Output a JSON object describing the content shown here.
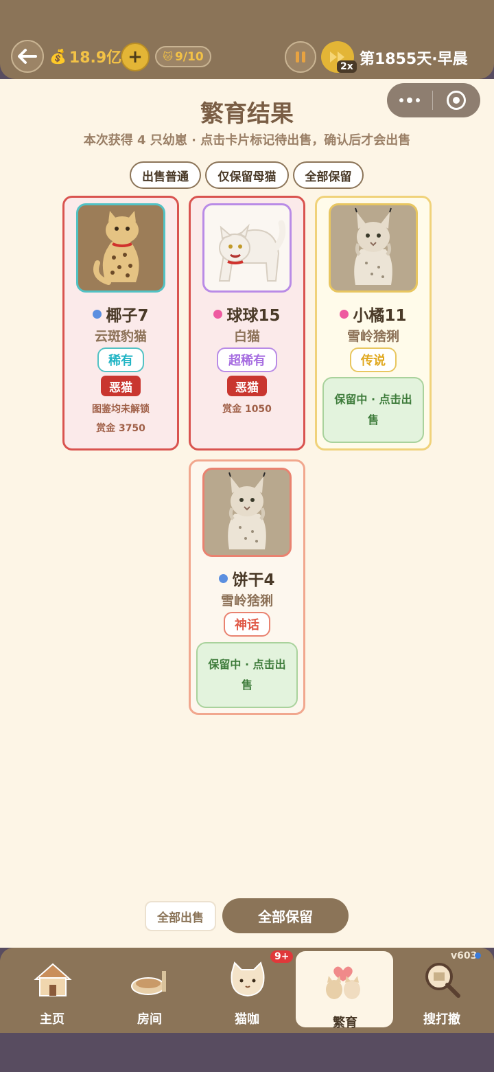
{
  "topbar": {
    "money": "18.9亿",
    "cat_count": "9/10",
    "speed": "2x",
    "day": "第1855天·早晨"
  },
  "page": {
    "title": "繁育结果",
    "subtitle": "本次获得 4 只幼崽 · 点击卡片标记待出售，确认后才会出售"
  },
  "filters": [
    "出售普通",
    "仅保留母猫",
    "全部保留"
  ],
  "cards": [
    {
      "name": "椰子7",
      "breed": "云斑豹猫",
      "rarity": "稀有",
      "tag": "恶猫",
      "note": "图鉴均未解锁",
      "bounty": "赏金 3750",
      "gender_color": "#5b8fe0",
      "rarity_color": "#20b4c4",
      "frame_color": "#52c2c4"
    },
    {
      "name": "球球15",
      "breed": "白猫",
      "rarity": "超稀有",
      "tag": "恶猫",
      "bounty": "赏金 1050",
      "gender_color": "#ee5aa0",
      "rarity_color": "#a56be0",
      "frame_color": "#b98be6"
    },
    {
      "name": "小橘11",
      "breed": "雪岭猞猁",
      "rarity": "传说",
      "keep": "保留中 · 点击出售",
      "gender_color": "#ee5aa0",
      "rarity_color": "#e0a820",
      "frame_color": "#e8c660"
    },
    {
      "name": "饼干4",
      "breed": "雪岭猞猁",
      "rarity": "神话",
      "keep": "保留中 · 点击出售",
      "gender_color": "#5b8fe0",
      "rarity_color": "#e05a48",
      "frame_color": "#e98270"
    }
  ],
  "actions": {
    "sell_all": "全部出售",
    "keep_all": "全部保留"
  },
  "tabs": [
    {
      "label": "主页",
      "icon": "house-icon"
    },
    {
      "label": "房间",
      "icon": "room-icon"
    },
    {
      "label": "猫咖",
      "icon": "cat-cafe-icon"
    },
    {
      "label": "繁育",
      "icon": "breeding-icon"
    },
    {
      "label": "搜打撤",
      "icon": "magnifier-icon"
    }
  ],
  "badge": "9+",
  "version": "v603"
}
